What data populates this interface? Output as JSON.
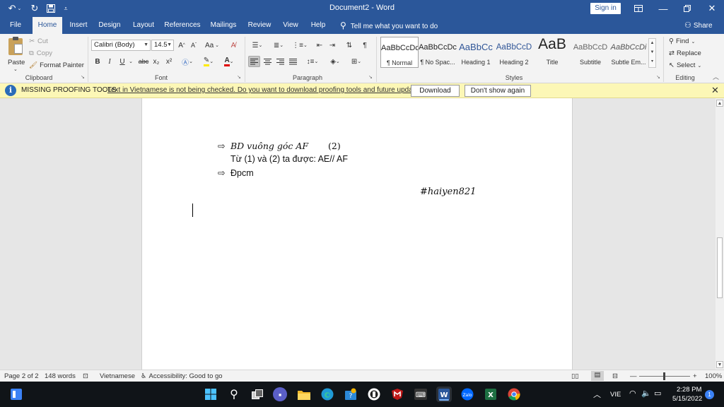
{
  "app": {
    "title": "Document2 - Word",
    "sign_in": "Sign in",
    "share": "Share",
    "tell_me": "Tell me what you want to do"
  },
  "tabs": [
    "File",
    "Home",
    "Insert",
    "Design",
    "Layout",
    "References",
    "Mailings",
    "Review",
    "View",
    "Help"
  ],
  "ribbon": {
    "clipboard": {
      "label": "Clipboard",
      "paste": "Paste",
      "cut": "Cut",
      "copy": "Copy",
      "format_painter": "Format Painter"
    },
    "font": {
      "label": "Font",
      "font_name": "Calibri (Body)",
      "font_size": "14.5",
      "change_case": "Aa",
      "bold": "B",
      "italic": "I",
      "underline": "U",
      "strike": "abc",
      "subscript": "x₂",
      "superscript": "x²"
    },
    "paragraph": {
      "label": "Paragraph"
    },
    "styles": {
      "label": "Styles",
      "items": [
        {
          "preview": "AaBbCcDc",
          "name": "¶ Normal"
        },
        {
          "preview": "AaBbCcDc",
          "name": "¶ No Spac..."
        },
        {
          "preview": "AaBbCc",
          "name": "Heading 1"
        },
        {
          "preview": "AaBbCcD",
          "name": "Heading 2"
        },
        {
          "preview": "AaB",
          "name": "Title"
        },
        {
          "preview": "AaBbCcD",
          "name": "Subtitle"
        },
        {
          "preview": "AaBbCcDi",
          "name": "Subtle Em..."
        }
      ]
    },
    "editing": {
      "label": "Editing",
      "find": "Find",
      "replace": "Replace",
      "select": "Select"
    }
  },
  "message_bar": {
    "title": "MISSING PROOFING TOOLS",
    "text": "Text in Vietnamese is not being checked. Do you want to download proofing tools and future updates?",
    "download": "Download",
    "dont_show": "Don't show again"
  },
  "document": {
    "line1_math": "BD vuông góc AF",
    "line1_ref": "(2)",
    "line2": "Từ (1) và (2) ta được: AE// AF",
    "line3": "Đpcm",
    "signature": "#haiyen821"
  },
  "status": {
    "page": "Page 2 of 2",
    "words": "148 words",
    "language": "Vietnamese",
    "accessibility": "Accessibility: Good to go",
    "zoom": "100%"
  },
  "taskbar": {
    "lang": "VIE",
    "time": "2:28 PM",
    "date": "5/15/2022",
    "notif_count": "1"
  },
  "colors": {
    "word_blue": "#2b579a",
    "message_bar": "#fcf7b6",
    "taskbar": "#101418"
  }
}
